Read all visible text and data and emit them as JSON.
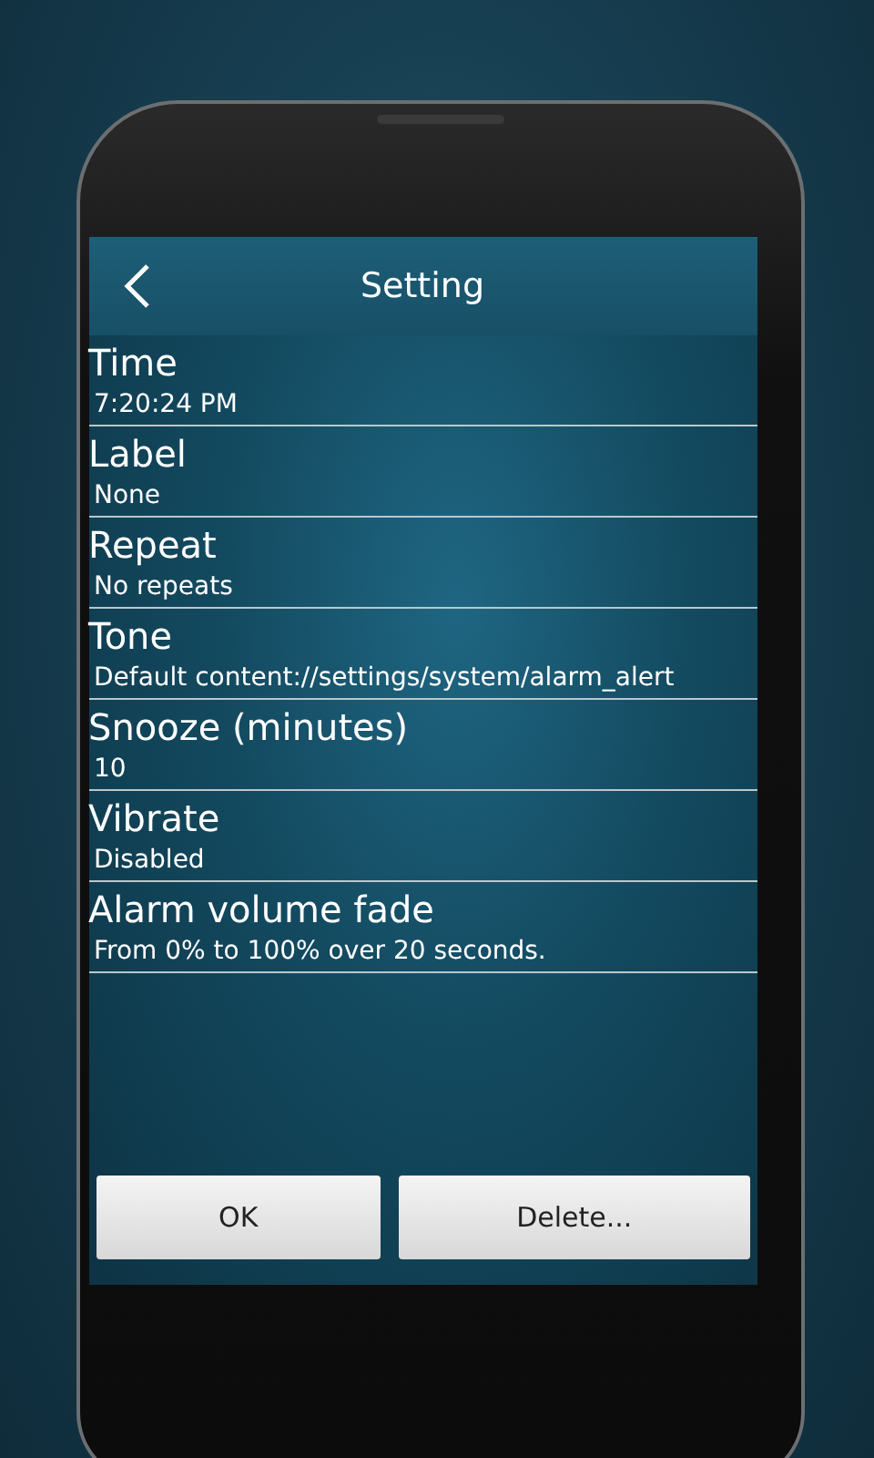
{
  "title": "Setting",
  "settings": [
    {
      "label": "Time",
      "value": "7:20:24 PM"
    },
    {
      "label": "Label",
      "value": "None"
    },
    {
      "label": "Repeat",
      "value": "No repeats"
    },
    {
      "label": "Tone",
      "value": "Default content://settings/system/alarm_alert"
    },
    {
      "label": "Snooze (minutes)",
      "value": "10"
    },
    {
      "label": "Vibrate",
      "value": "Disabled"
    },
    {
      "label": "Alarm volume fade",
      "value": "From 0% to 100% over 20 seconds."
    }
  ],
  "buttons": [
    "OK",
    "Delete..."
  ]
}
